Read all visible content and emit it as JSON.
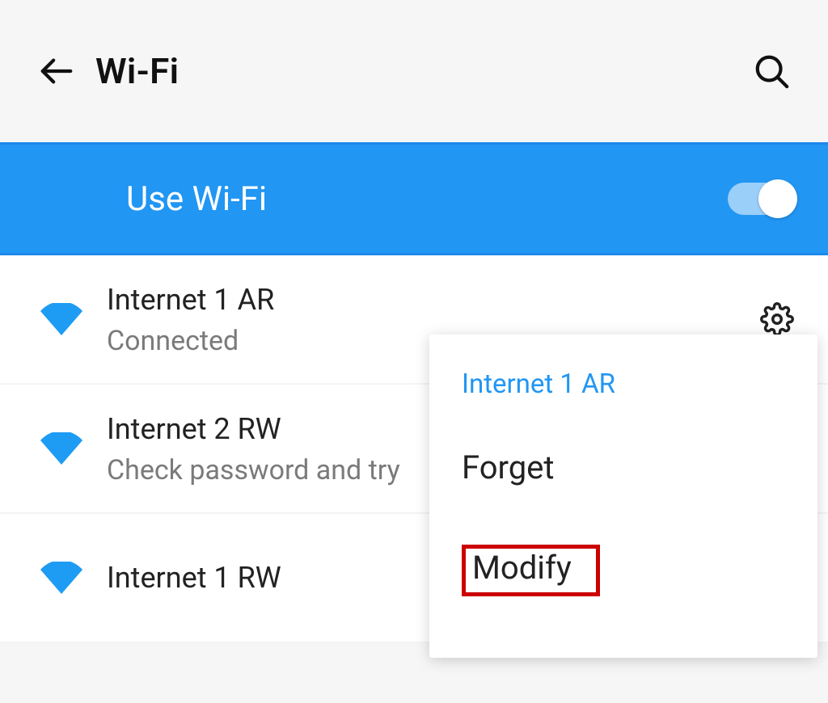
{
  "header": {
    "title": "Wi-Fi"
  },
  "use_wifi": {
    "label": "Use Wi-Fi",
    "enabled": true
  },
  "networks": [
    {
      "ssid": "Internet 1 AR",
      "status": "Connected",
      "has_settings": true
    },
    {
      "ssid": "Internet 2 RW",
      "status": "Check password and try",
      "has_settings": false
    },
    {
      "ssid": "Internet 1 RW",
      "status": "",
      "has_settings": false
    }
  ],
  "context_menu": {
    "title": "Internet 1 AR",
    "items": [
      {
        "label": "Forget"
      },
      {
        "label": "Modify",
        "highlighted": true
      }
    ]
  },
  "colors": {
    "accent": "#2196f3",
    "highlight_border": "#cc0001"
  }
}
